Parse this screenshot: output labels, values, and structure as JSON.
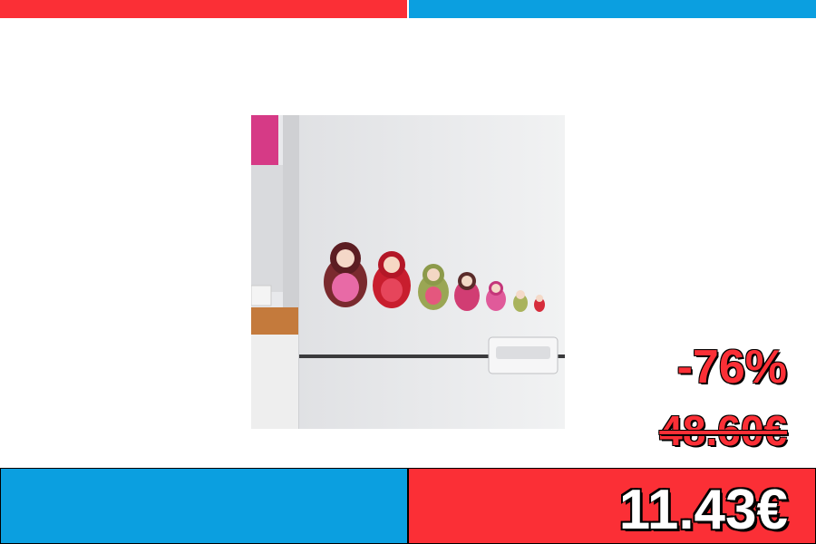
{
  "offer": {
    "discount": "-76%",
    "old_price": "48.60€",
    "new_price": "11.43€"
  },
  "colors": {
    "accent_red": "#fb2f36",
    "accent_blue": "#0b9fe0"
  },
  "product_image": {
    "icon": "nesting-dolls-wall-sticker-photo"
  }
}
